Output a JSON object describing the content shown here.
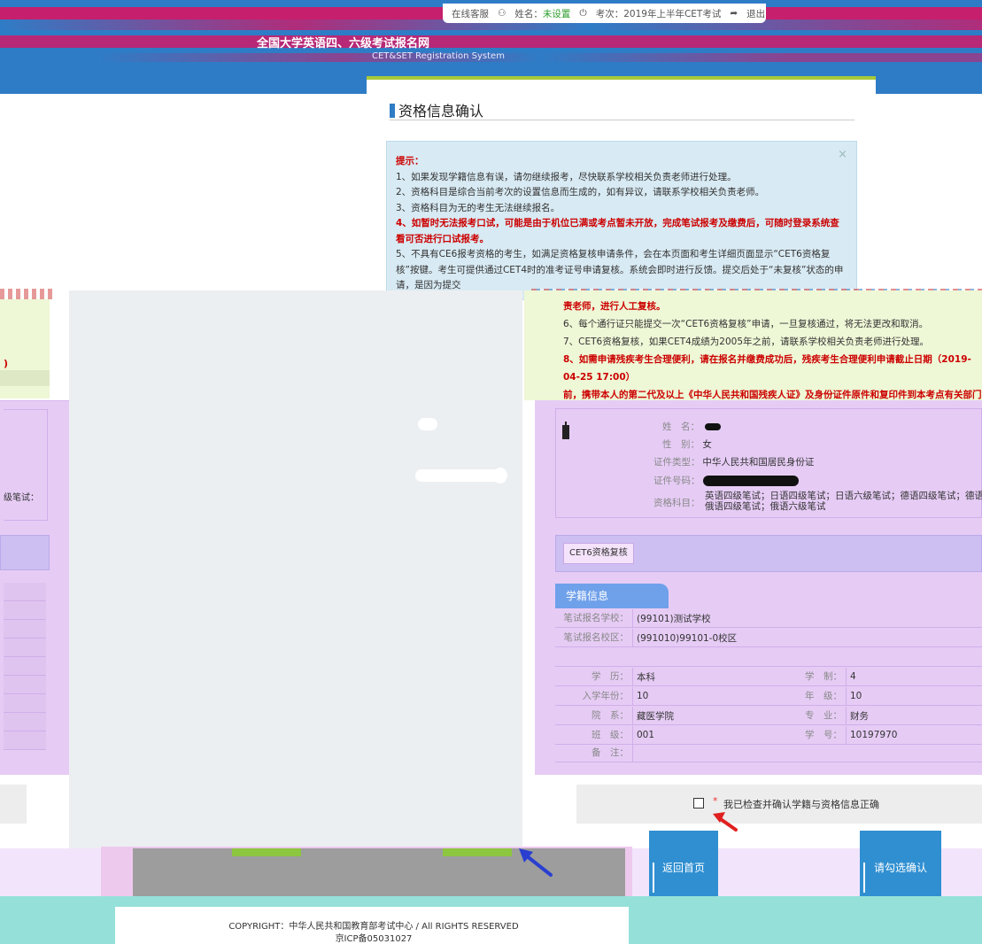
{
  "topbar": {
    "service": "在线客服",
    "name_label": "姓名：",
    "name_value": "未设置",
    "exam_label": "考次：2019年上半年CET考试",
    "logout": "退出"
  },
  "header": {
    "logo_title": "全国大学英语四、六级考试报名网",
    "logo_sub": "CET&SET Registration System"
  },
  "panel": {
    "title": "资格信息确认",
    "notice_title": "提示：",
    "notice_items": [
      "1、如果发现学籍信息有误，请勿继续报考，尽快联系学校相关负责老师进行处理。",
      "2、资格科目是综合当前考次的设置信息而生成的，如有异议，请联系学校相关负责老师。",
      "3、资格科目为无的考生无法继续报名。",
      "4、如暂时无法报考口试，可能是由于机位已满或考点暂未开放，完成笔试报考及缴费后，可随时登录系统查看可否进行口试报考。",
      "5、不具有CE6报考资格的考生，如满足资格复核申请条件，会在本页面和考生详细页面显示“CET6资格复核”按键。考生可提供通过CET4时的准考证号申请复核。系统会即时进行反馈。提交后处于“未复核”状态的申请，是因为提交"
    ],
    "notice2_items": [
      "责老师，进行人工复核。",
      "6、每个通行证只能提交一次“CET6资格复核”申请，一旦复核通过，将无法更改和取消。",
      "7、CET6资格复核，如果CET4成绩为2005年之前，请联系学校相关负责老师进行处理。",
      "8、如需申请残疾考生合理便利，请在报名并缴费成功后，残疾考生合理便利申请截止日期（2019-04-25 17:00）",
      "前，携带本人的第二代及以上《中华人民共和国残疾人证》及身份证件原件和复印件到本考点有关部门办理。"
    ]
  },
  "left": {
    "paren": ")",
    "cut_text": "级笔试："
  },
  "person": {
    "name_label": "姓　名：",
    "gender_label": "性　别：",
    "gender_value": "女",
    "idtype_label": "证件类型：",
    "idtype_value": "中华人民共和国居民身份证",
    "idno_label": "证件号码：",
    "subjects_label": "资格科目：",
    "subjects_line1": "英语四级笔试；日语四级笔试；日语六级笔试；德语四级笔试；德语六级",
    "subjects_line2": "俄语四级笔试；俄语六级笔试"
  },
  "cet6_button": "CET6资格复核",
  "xueji": {
    "tab": "学籍信息",
    "school_label": "笔试报名学校：",
    "school_value": "(99101)测试学校",
    "campus_label": "笔试报名校区：",
    "campus_value": "(991010)99101-0校区",
    "rows": [
      {
        "l1": "学　历：",
        "v1": "本科",
        "l2": "学　制：",
        "v2": "4"
      },
      {
        "l1": "入学年份：",
        "v1": "10",
        "l2": "年　级：",
        "v2": "10"
      },
      {
        "l1": "院　系：",
        "v1": "藏医学院",
        "l2": "专　业：",
        "v2": "财务"
      },
      {
        "l1": "班　级：",
        "v1": "001",
        "l2": "学　号：",
        "v2": "10197970"
      },
      {
        "l1": "备　注：",
        "v1": "",
        "l2": "",
        "v2": ""
      }
    ]
  },
  "confirm": {
    "star": "*",
    "text": "我已检查并确认学籍与资格信息正确"
  },
  "buttons": {
    "home": "返回首页",
    "confirm": "请勾选确认"
  },
  "footer": {
    "copyright": "COPYRIGHT：中华人民共和国教育部考试中心 / All RIGHTS RESERVED",
    "icp": "京ICP备05031027"
  },
  "colors": {
    "header_blue": "#2f7cc6",
    "glitch_magenta": "#c61f6d",
    "accent_green": "#a7c939",
    "button_blue": "#2f8fd1",
    "alert_red": "#cc0000"
  }
}
